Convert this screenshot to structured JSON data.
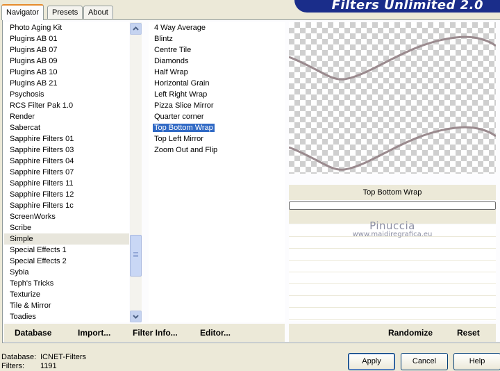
{
  "tabs": [
    {
      "label": "Navigator"
    },
    {
      "label": "Presets"
    },
    {
      "label": "About"
    }
  ],
  "brand": "Filters Unlimited 2.0",
  "categories": [
    "Photo Aging Kit",
    "Plugins AB 01",
    "Plugins AB 07",
    "Plugins AB 09",
    "Plugins AB 10",
    "Plugins AB 21",
    "Psychosis",
    "RCS Filter Pak 1.0",
    "Render",
    "Sabercat",
    "Sapphire Filters 01",
    "Sapphire Filters 03",
    "Sapphire Filters 04",
    "Sapphire Filters 07",
    "Sapphire Filters 11",
    "Sapphire Filters 12",
    "Sapphire Filters 1c",
    "ScreenWorks",
    "Scribe",
    "Simple",
    "Special Effects 1",
    "Special Effects 2",
    "Sybia",
    "Teph's Tricks",
    "Texturize",
    "Tile & Mirror",
    "Toadies"
  ],
  "selected_category": "Simple",
  "filters": [
    "4 Way Average",
    "Blintz",
    "Centre Tile",
    "Diamonds",
    "Half Wrap",
    "Horizontal Grain",
    "Left Right Wrap",
    "Pizza Slice Mirror",
    "Quarter corner",
    "Top Bottom Wrap",
    "Top Left Mirror",
    "Zoom Out and Flip"
  ],
  "selected_filter": "Top Bottom Wrap",
  "preview_filter_name": "Top Bottom Wrap",
  "watermark": {
    "name": "Pinuccia",
    "url": "www.maidiregrafica.eu"
  },
  "bottom_links": {
    "database": "Database",
    "import": "Import...",
    "filter_info": "Filter Info...",
    "editor": "Editor...",
    "randomize": "Randomize",
    "reset": "Reset"
  },
  "status": {
    "database_label": "Database:",
    "database_value": "ICNET-Filters",
    "filters_label": "Filters:",
    "filters_value": "1191"
  },
  "buttons": {
    "apply": "Apply",
    "cancel": "Cancel",
    "help": "Help"
  },
  "colors": {
    "accent": "#e68b2c",
    "brand_bar": "#1a2d8a",
    "selection": "#316ac5",
    "wave": "#9a8a8e"
  },
  "icons": {
    "scroll_up": "chevron-up-icon",
    "scroll_down": "chevron-down-icon"
  }
}
